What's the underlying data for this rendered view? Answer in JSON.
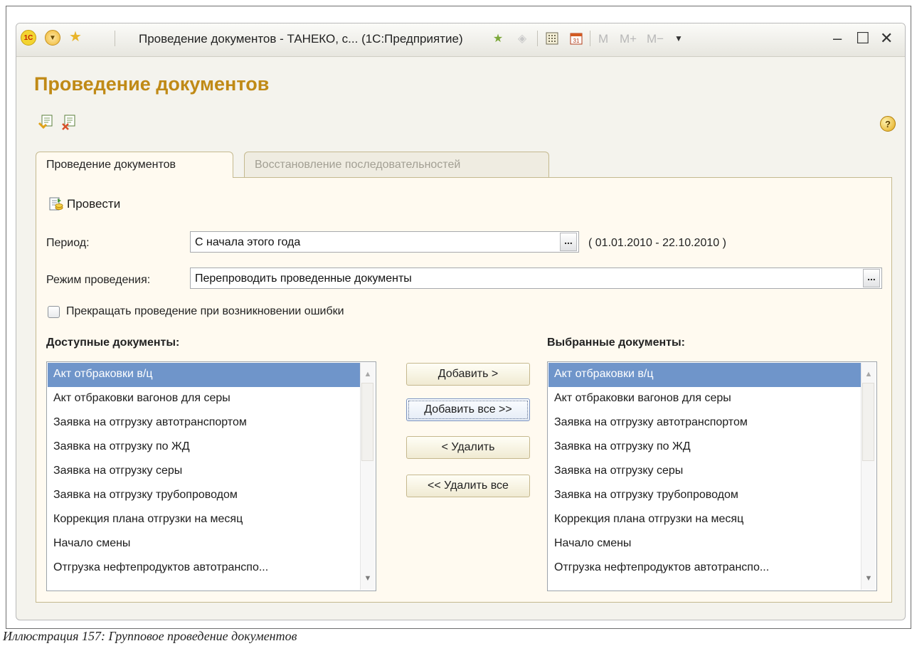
{
  "window": {
    "title": "Проведение документов - ТАНЕКО, с...  (1С:Предприятие)",
    "logo_text": "1С",
    "mem_buttons": [
      "M",
      "M+",
      "M−"
    ],
    "controls": {
      "minimize": "–",
      "maximize": "☐",
      "close": "✕"
    }
  },
  "page": {
    "title": "Проведение документов"
  },
  "help": {
    "label": "?"
  },
  "tabs": [
    {
      "label": "Проведение документов",
      "active": true
    },
    {
      "label": "Восстановление последовательностей",
      "active": false
    }
  ],
  "toolbar": {
    "run_label": "Провести"
  },
  "period": {
    "label": "Период:",
    "value": "С начала этого года",
    "range_text": "( 01.01.2010 - 22.10.2010 )",
    "choose_label": "..."
  },
  "mode": {
    "label": "Режим проведения:",
    "value": "Перепроводить проведенные документы",
    "choose_label": "..."
  },
  "stop_on_error": {
    "label": "Прекращать проведение при возникновении ошибки",
    "checked": false
  },
  "available": {
    "title": "Доступные документы:",
    "items": [
      "Акт отбраковки в/ц",
      "Акт отбраковки вагонов для серы",
      "Заявка на отгрузку автотранспортом",
      "Заявка на отгрузку по ЖД",
      "Заявка на отгрузку серы",
      "Заявка на отгрузку трубопроводом",
      "Коррекция плана отгрузки на месяц",
      "Начало смены",
      "Отгрузка нефтепродуктов автотранспо..."
    ],
    "selected_index": 0
  },
  "selected": {
    "title": "Выбранные документы:",
    "items": [
      "Акт отбраковки в/ц",
      "Акт отбраковки вагонов для серы",
      "Заявка на отгрузку автотранспортом",
      "Заявка на отгрузку по ЖД",
      "Заявка на отгрузку серы",
      "Заявка на отгрузку трубопроводом",
      "Коррекция плана отгрузки на месяц",
      "Начало смены",
      "Отгрузка нефтепродуктов автотранспо..."
    ],
    "selected_index": 0
  },
  "buttons": {
    "add": "Добавить >",
    "add_all": "Добавить все >>",
    "remove": "< Удалить",
    "remove_all": "<< Удалить все"
  },
  "scrollbar": {
    "up": "▲",
    "down": "▼"
  },
  "caption": "Иллюстрация 157: Групповое проведение документов",
  "colors": {
    "title_accent": "#c08a16",
    "selection": "#6f95ca"
  }
}
